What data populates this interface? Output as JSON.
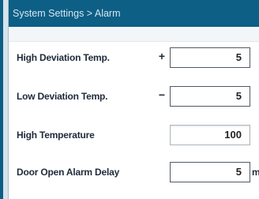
{
  "header": {
    "title": "System Settings > Alarm"
  },
  "colors": {
    "header_bg": "#0d5f86",
    "header_text": "#d6e6ef",
    "label_text": "#1f2a3a"
  },
  "settings": [
    {
      "label": "High Deviation Temp.",
      "sign": "+",
      "value": "5",
      "unit": ""
    },
    {
      "label": "Low Deviation Temp.",
      "sign": "−",
      "value": "5",
      "unit": ""
    },
    {
      "label": "High Temperature",
      "sign": "",
      "value": "100",
      "unit": ""
    },
    {
      "label": "Door Open Alarm Delay",
      "sign": "",
      "value": "5",
      "unit": "m"
    }
  ]
}
